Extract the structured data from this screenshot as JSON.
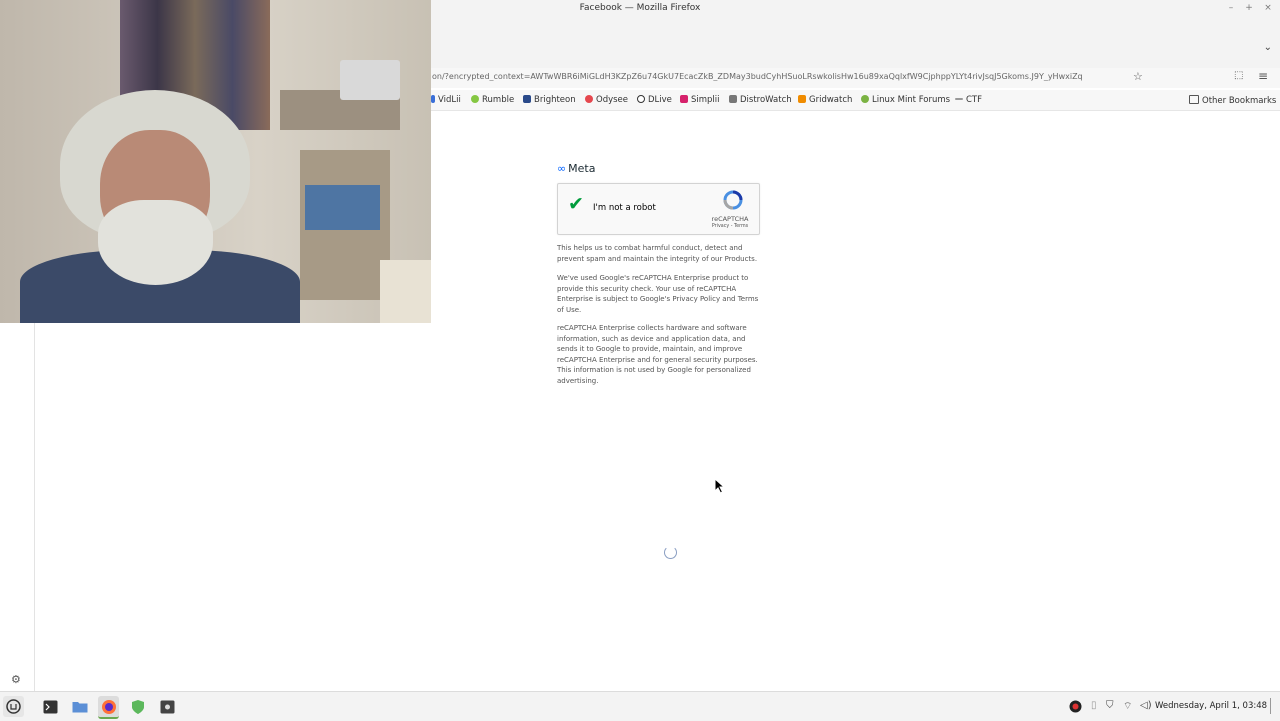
{
  "window": {
    "title": "Facebook — Mozilla Firefox",
    "controls": {
      "minimize": "–",
      "maximize": "+",
      "close": "×"
    }
  },
  "tabstrip": {
    "list_all_tabs": "⌄"
  },
  "navbar": {
    "url": "on/?encrypted_context=AWTwWBR6iMiGLdH3KZpZ6u74GkU7EcacZkB_ZDMay3budCyhHSuoLRswkolisHw16u89xaQqlxfW9CjphppYLYt4rivJsqJ5Gkoms.J9Y_yHwxiZq",
    "star": "☆",
    "extensions": "⬚",
    "menu": "≡"
  },
  "bookmarks": {
    "items": [
      {
        "label": "VidLii",
        "color": "#3a6fd8"
      },
      {
        "label": "Rumble",
        "color": "#85c742"
      },
      {
        "label": "Brighteon",
        "color": "#2a4a8a"
      },
      {
        "label": "Odysee",
        "color": "#e5474e"
      },
      {
        "label": "DLive",
        "color": "#333333"
      },
      {
        "label": "Simplii",
        "color": "#d6216b"
      },
      {
        "label": "DistroWatch",
        "color": "#777777"
      },
      {
        "label": "Gridwatch",
        "color": "#f08c00"
      },
      {
        "label": "Linux Mint Forums",
        "color": "#7bb343"
      },
      {
        "label": "CTF",
        "color": "#999999"
      }
    ],
    "other": "Other Bookmarks"
  },
  "page": {
    "brand": "Meta",
    "captcha": {
      "label": "I'm not a robot",
      "brand": "reCAPTCHA",
      "links": "Privacy - Terms"
    },
    "paragraphs": [
      "This helps us to combat harmful conduct, detect and prevent spam and maintain the integrity of our Products.",
      "We've used Google's reCAPTCHA Enterprise product to provide this security check. Your use of reCAPTCHA Enterprise is subject to Google's Privacy Policy and Terms of Use.",
      "reCAPTCHA Enterprise collects hardware and software information, such as device and application data, and sends it to Google to provide, maintain, and improve reCAPTCHA Enterprise and for general security purposes. This information is not used by Google for personalized advertising."
    ]
  },
  "taskbar": {
    "clock": "Wednesday, April  1, 03:48"
  }
}
